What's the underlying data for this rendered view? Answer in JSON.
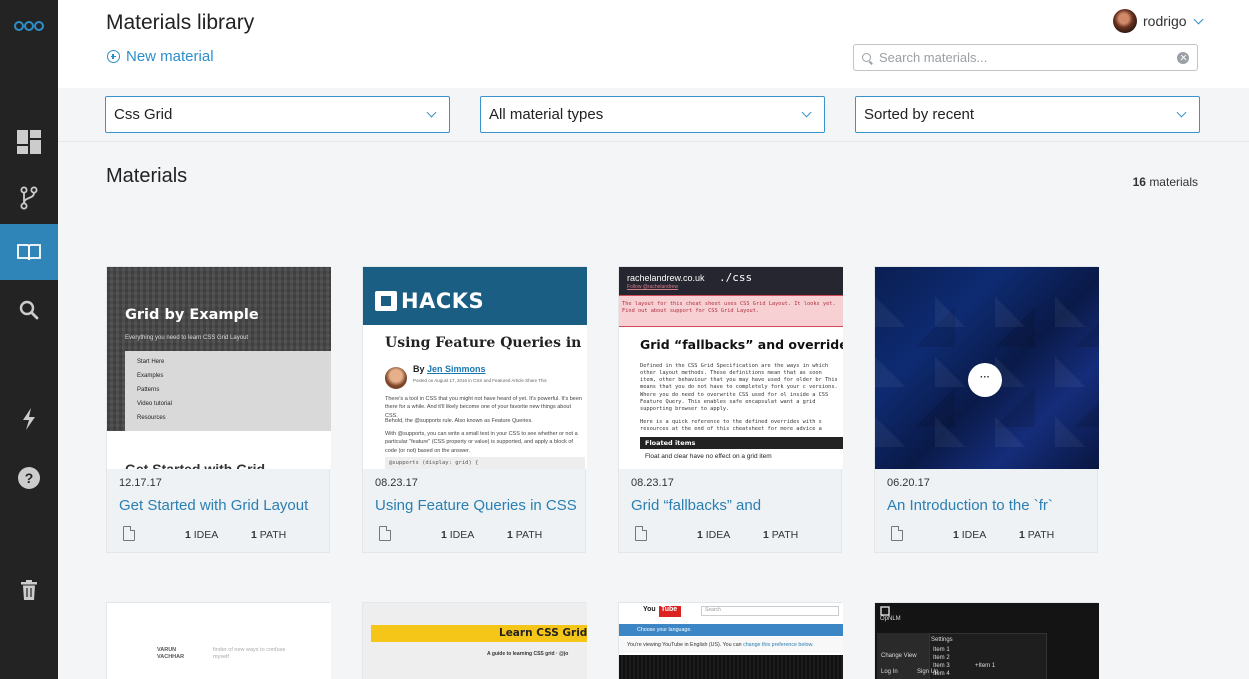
{
  "app": {
    "page_title": "Materials library",
    "new_material_label": "New material"
  },
  "user": {
    "name": "rodrigo"
  },
  "search": {
    "placeholder": "Search materials...",
    "value": ""
  },
  "filters": {
    "topic": "Css Grid",
    "type": "All material types",
    "sort": "Sorted by recent"
  },
  "sidebar": {
    "icons": [
      "logo-icon",
      "dashboard-icon",
      "branch-icon",
      "book-icon",
      "search-icon",
      "lightning-icon",
      "help-icon",
      "trash-icon"
    ],
    "active": "book-icon",
    "accent_color": "#3085b8"
  },
  "main": {
    "section_title": "Materials",
    "count_number": "16",
    "count_label": "materials"
  },
  "cards": [
    {
      "date": "12.17.17",
      "title": "Get Started with Grid Layout",
      "ideas_count": "1",
      "ideas_label": "IDEA",
      "paths_count": "1",
      "paths_label": "PATH",
      "thumb": {
        "heading": "Grid by Example",
        "subheading": "Everything you need to learn CSS Grid Layout",
        "menu": [
          "Start Here",
          "Examples",
          "Patterns",
          "Video tutorial",
          "Resources"
        ],
        "bottom_text": "Get Started with Grid"
      }
    },
    {
      "date": "08.23.17",
      "title": "Using Feature Queries in CSS",
      "ideas_count": "1",
      "ideas_label": "IDEA",
      "paths_count": "1",
      "paths_label": "PATH",
      "thumb": {
        "brand": "HACKS",
        "heading": "Using Feature Queries in",
        "by": "By",
        "author": "Jen Simmons",
        "posted": "Posted on August 17, 2016 in CSS and Featured Article  Share This",
        "para1": "There's a tool in CSS that you might not have heard of yet. It's powerful. It's been there for a while. And it'll likely become one of your favorite new things about CSS.",
        "para2": "Behold, the @supports rule. Also known as Feature Queries.",
        "para3": "With @supports, you can write a small test in your CSS to see whether or not a particular \"feature\" (CSS property or value) is supported, and apply a block of code (or not) based on the answer.",
        "code": "@supports (display: grid) {"
      }
    },
    {
      "date": "08.23.17",
      "title": "Grid “fallbacks” and",
      "ideas_count": "1",
      "ideas_label": "IDEA",
      "paths_count": "1",
      "paths_label": "PATH",
      "thumb": {
        "site": "rachelandrew.co.uk",
        "css": "./css",
        "follow": "Follow @rachelandrew",
        "notice": "The layout for this cheat sheet uses CSS Grid Layout. It looks yet. Find out about support for CSS Grid Layout.",
        "heading": "Grid “fallbacks” and overrides",
        "para1": "Defined in the CSS Grid Specification are the ways in which other layout methods. These definitions mean that as soon item, other behaviour that you may have used for older br This means that you do not have to completely fork your c versions. Where you do need to overwrite CSS used for ol inside a CSS Feature Query. This enables safe encapsulat want a grid supporting browser to apply.",
        "para2": "Here is a quick reference to the defined overrides with s resources at the end of this cheatsheet for more advice a",
        "floated": "Floated items",
        "float_text": "Float and clear have no effect on a grid item"
      }
    },
    {
      "date": "06.20.17",
      "title": "An Introduction to the `fr`",
      "ideas_count": "1",
      "ideas_label": "IDEA",
      "paths_count": "1",
      "paths_label": "PATH",
      "thumb": {
        "more": "···"
      }
    }
  ],
  "lower_cards": [
    {
      "author": "VARUN VACHHAR",
      "tagline": "finder of new ways to confuse myself"
    },
    {
      "banner": "Learn CSS Grid",
      "sub": "A guide to learning CSS grid · @jo"
    },
    {
      "yt_brand": "You",
      "yt_tube": "Tube",
      "search_placeholder": "Search",
      "language_bar": "Choose your language.",
      "notice": "You're viewing YouTube in English (US). You can",
      "notice_link": "change this preference below."
    },
    {
      "brand": "OpNLM",
      "title": "Settings",
      "menu": [
        "Change View",
        "Log In",
        "Sign Up"
      ],
      "items": [
        "Item 1",
        "Item 2",
        "Item 3",
        "Item 4"
      ],
      "prefix": "+Item 1"
    }
  ]
}
